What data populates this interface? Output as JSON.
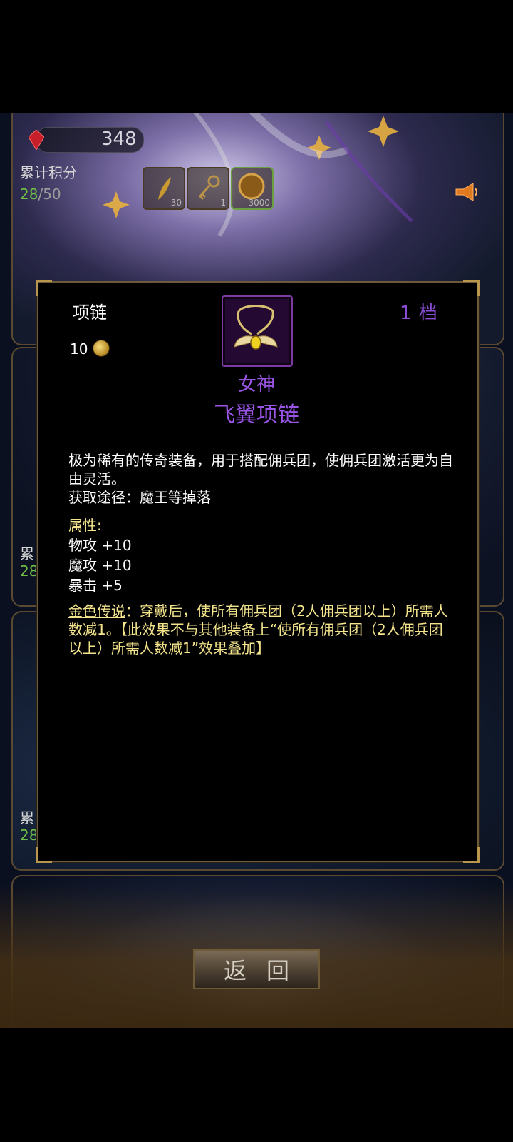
{
  "background": {
    "score": "348",
    "cumulative_label": "累计积分",
    "progress_current": "28",
    "progress_total": "/50",
    "rewards": [
      {
        "icon": "feather-icon",
        "count": "30"
      },
      {
        "icon": "key-icon",
        "count": "1"
      },
      {
        "icon": "coin-icon",
        "count": "3000"
      }
    ],
    "card2_label": "累",
    "card2_num": "28",
    "card3_label": "累",
    "card3_num": "28"
  },
  "modal": {
    "slot_name": "项链",
    "tier": "1  档",
    "price": "10",
    "item_name_line1": "女神",
    "item_name_line2": "飞翼项链",
    "description": "极为稀有的传奇装备，用于搭配佣兵团，使佣兵团激活更为自由灵活。",
    "source": "获取途径：魔王等掉落",
    "attr_title": "属性:",
    "stats": [
      "物攻 +10",
      "魔攻 +10",
      "暴击 +5"
    ],
    "gold_label": "金色传说",
    "gold_text": "：穿戴后，使所有佣兵团（2人佣兵团以上）所需人数减1。【此效果不与其他装备上“使所有佣兵团（2人佣兵团以上）所需人数减1”效果叠加】"
  },
  "back_button": "返回",
  "colors": {
    "tier_purple": "#8c4ed8",
    "item_name_purple": "#9a54e6",
    "attr_gold": "#f4e58c",
    "progress_green": "#6fbf46"
  }
}
